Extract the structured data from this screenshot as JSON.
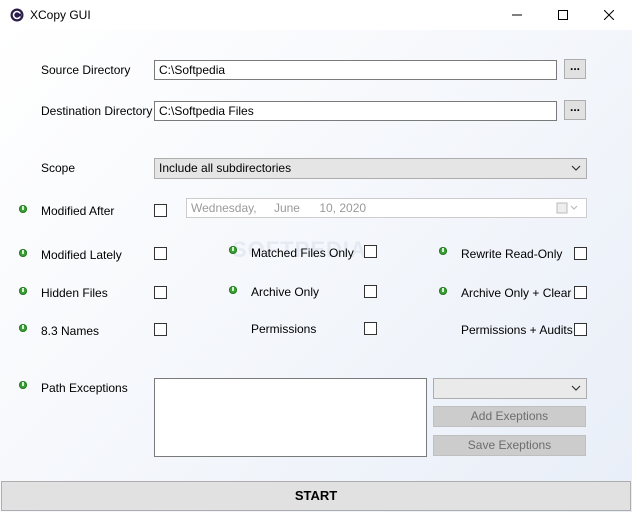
{
  "window": {
    "title": "XCopy GUI"
  },
  "source": {
    "label": "Source Directory",
    "value": "C:\\Softpedia",
    "browse_label": "..."
  },
  "destination": {
    "label": "Destination Directory",
    "value": "C:\\Softpedia Files",
    "browse_label": "..."
  },
  "scope": {
    "label": "Scope",
    "selected": "Include all subdirectories"
  },
  "modified_after": {
    "label": "Modified After",
    "checked": false,
    "date": {
      "weekday": "Wednesday,",
      "month": "June",
      "day_year": "10, 2020"
    }
  },
  "options": {
    "modified_lately": "Modified Lately",
    "matched_files_only": "Matched Files Only",
    "rewrite_read_only": "Rewrite Read-Only",
    "hidden_files": "Hidden Files",
    "archive_only": "Archive Only",
    "archive_only_clear": "Archive Only + Clear",
    "names_83": "8.3 Names",
    "permissions": "Permissions",
    "permissions_audits": "Permissions + Audits"
  },
  "path_exceptions": {
    "label": "Path Exceptions",
    "value": "",
    "selected": ""
  },
  "buttons": {
    "add_exceptions": "Add Exeptions",
    "save_exceptions": "Save Exeptions",
    "start": "START"
  },
  "watermark": "SOFTPEDIA",
  "colors": {
    "info_dot": "#3aa235",
    "disabled_button": "#cccccc",
    "start_button": "#e1e1e1"
  }
}
